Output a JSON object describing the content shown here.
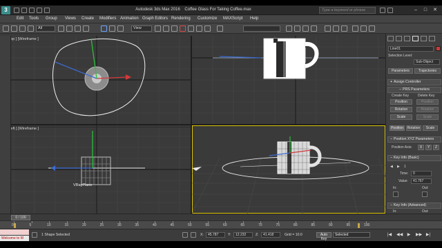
{
  "title_bar": {
    "app_name": "Autodesk 3ds Max 2016",
    "file_name": "Coffee Glass For Taking Coffee.max",
    "search_placeholder": "Type a keyword or phrase",
    "logo_letter": "3",
    "minimize_glyph": "–",
    "maximize_glyph": "□",
    "close_glyph": "✕"
  },
  "menu": [
    "Edit",
    "Tools",
    "Group",
    "Views",
    "Create",
    "Modifiers",
    "Animation",
    "Graph Editors",
    "Rendering",
    "Customize",
    "MAXScript",
    "Help"
  ],
  "toolbar": {
    "selection_filter": "All",
    "reference_coord": "View",
    "named_selection": ""
  },
  "viewports": {
    "top": "[+] [Top ] [Wireframe ]",
    "front": "",
    "left": "[+] [Left ] [Wireframe ]",
    "perspective": "",
    "left_object_label": "VRayPlane"
  },
  "command_panel": {
    "object_name": "Line01",
    "object_color": "#d23a3a",
    "selection_level_label": "Selection Level:",
    "sub_object_value": "Sub-Object",
    "parameters_tab": "Parameters",
    "trajectories_tab": "Trajectories",
    "assign_controller": "Assign Controller",
    "prs_parameters": "PRS Parameters",
    "create_key": "Create Key",
    "delete_key": "Delete Key",
    "prs_rows": [
      [
        "Position",
        "Position"
      ],
      [
        "Rotation",
        "Rotation"
      ],
      [
        "Scale",
        "Scale"
      ]
    ],
    "tabs_bottom": [
      "Position",
      "Rotation",
      "Scale"
    ],
    "position_xyz_parameters": "Position XYZ Parameters",
    "position_axis_label": "Position Axis:",
    "axes": [
      "X",
      "Y",
      "Z"
    ],
    "key_info_basic": "Key Info (Basic)",
    "key_number": "1",
    "time_label": "Time:",
    "time_value": "0",
    "value_label": "Value:",
    "value_value": "41.767",
    "in_label": "In:",
    "out_label": "Out:",
    "key_info_advanced": "Key Info (Advanced)",
    "in_label_2": "In:",
    "out_label_2": "Out:"
  },
  "timeline": {
    "slider_label": "0 / 100",
    "ticks": [
      "0",
      "5",
      "10",
      "15",
      "20",
      "25",
      "30",
      "35",
      "40",
      "45",
      "50",
      "55",
      "60",
      "65",
      "70",
      "75",
      "80",
      "85",
      "90",
      "95",
      "100"
    ]
  },
  "status": {
    "script_text": "Welcome to M",
    "selection_text": "1 Shape Selected",
    "x_label": "X:",
    "x_value": "45.787",
    "y_label": "Y:",
    "y_value": "12.232",
    "z_label": "Z:",
    "z_value": "41.418",
    "grid_label": "Grid = 10.0",
    "auto_key": "Auto Key",
    "selected_dropdown": "Selected",
    "playback": [
      "|◀",
      "◀◀",
      "▶",
      "▶▶",
      "▶|"
    ]
  },
  "colors": {
    "viewport_bg": "#3a3a3a",
    "active_border": "#e0c800",
    "x_axis": "#d23a3a",
    "y_axis": "#2bbf3a",
    "z_axis": "#3a6bd2"
  }
}
